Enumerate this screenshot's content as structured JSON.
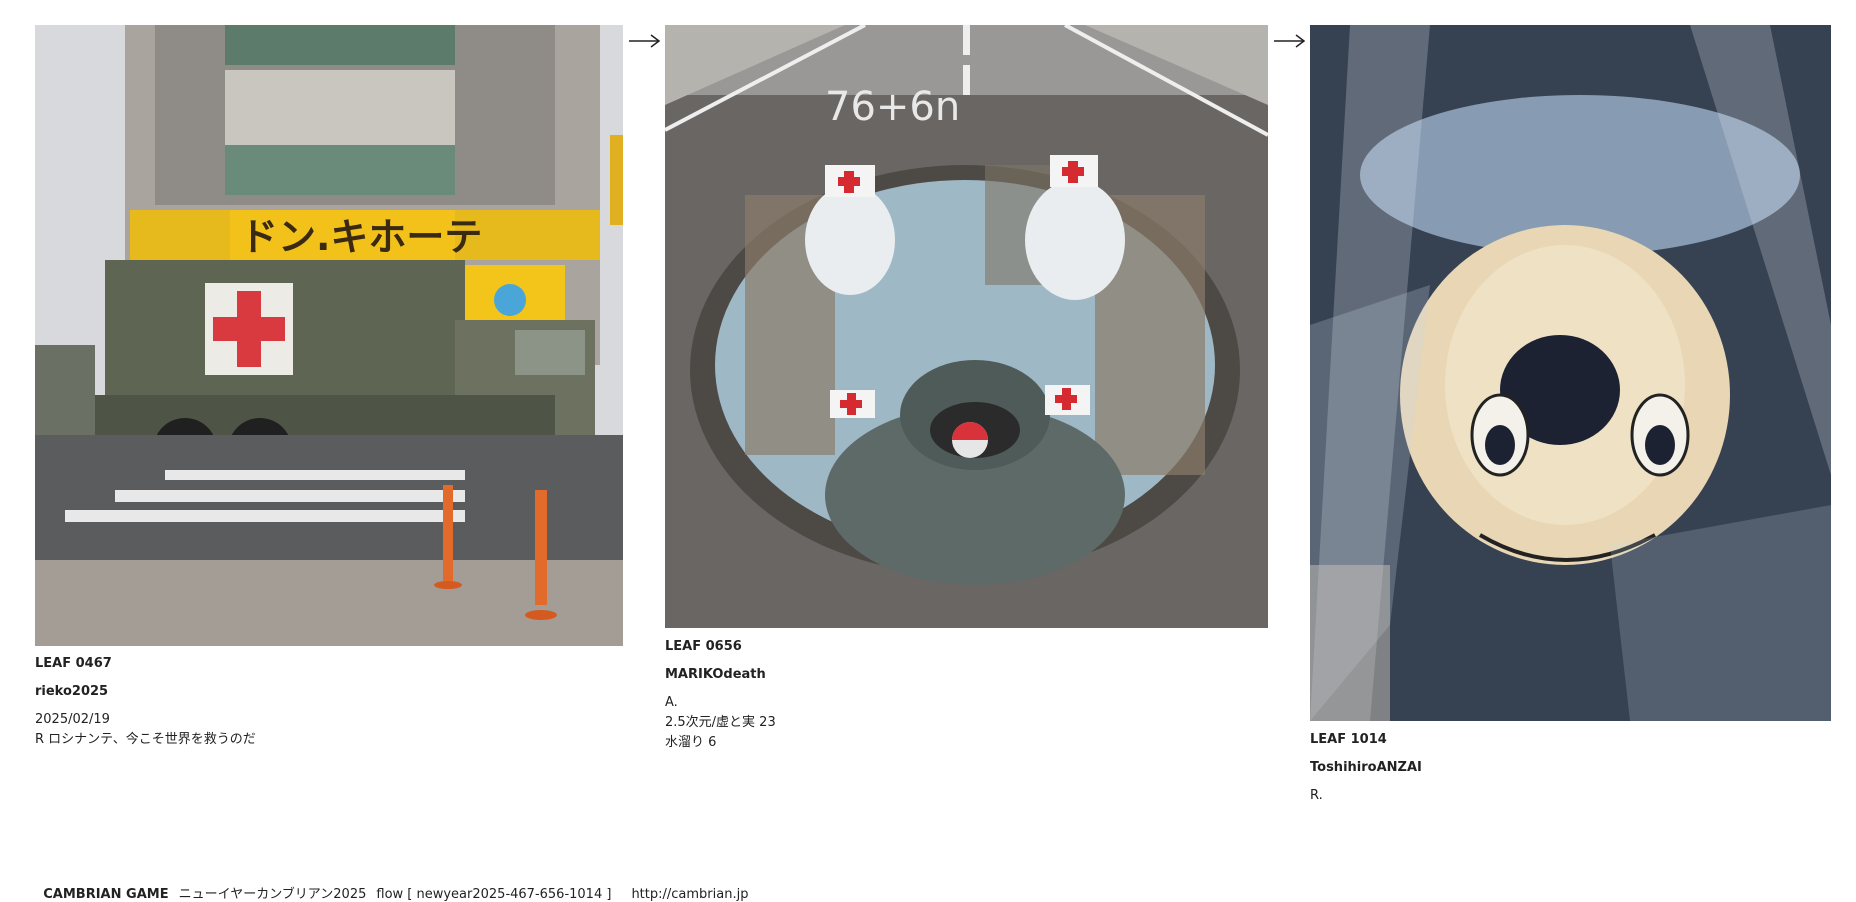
{
  "leaves": [
    {
      "id_label": "LEAF 0467",
      "author": "rieko2025",
      "date": "2025/02/19",
      "note": "R ロシナンテ、今こそ世界を救うのだ",
      "photo_desc_icon": "truck-photo",
      "sign_text": "ドン.キホーテ"
    },
    {
      "id_label": "LEAF 0656",
      "author": "MARIKOdeath",
      "type_line": "A.",
      "title_line": "2.5次元/虚と実 23",
      "sub_line": "水溜り 6",
      "photo_desc_icon": "puddle-photo",
      "road_text": "76+6n"
    },
    {
      "id_label": "LEAF 1014",
      "author": "ToshihiroANZAI",
      "type_line": "R.",
      "photo_desc_icon": "plush-photo"
    }
  ],
  "footer": {
    "game": "CAMBRIAN GAME",
    "event": "ニューイヤーカンブリアン2025",
    "flow": "flow [ newyear2025-467-656-1014 ]",
    "url": "http://cambrian.jp"
  }
}
